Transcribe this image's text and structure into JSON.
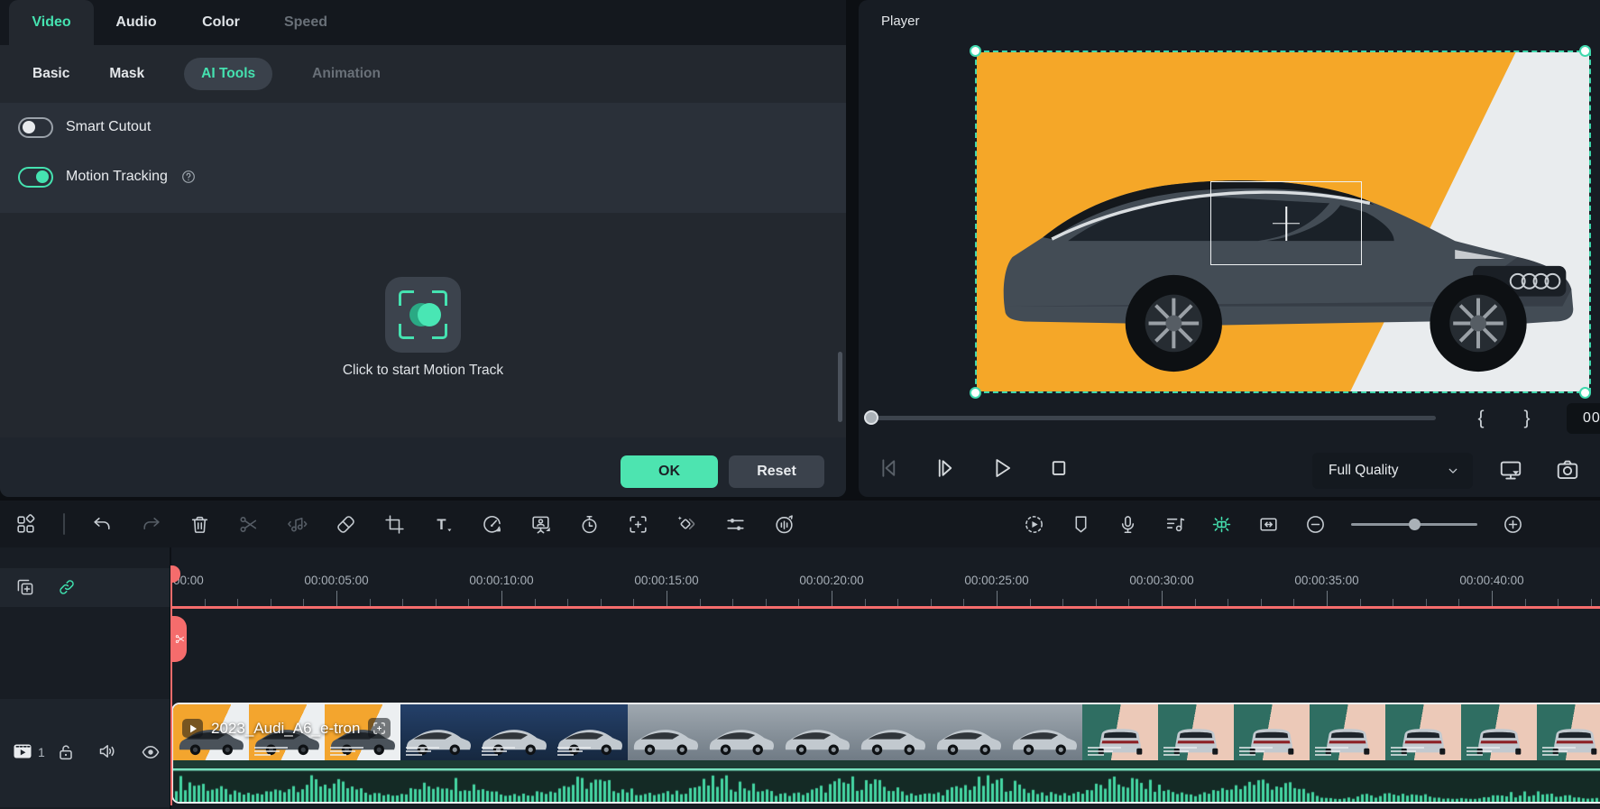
{
  "colors": {
    "accent": "#45e2b0",
    "red": "#f56c6c",
    "orange": "#f5a728",
    "ok_button": "#4de4b0"
  },
  "left_panel": {
    "tabs": [
      {
        "label": "Video",
        "state": "active"
      },
      {
        "label": "Audio",
        "state": "normal"
      },
      {
        "label": "Color",
        "state": "normal"
      },
      {
        "label": "Speed",
        "state": "disabled"
      }
    ],
    "subtabs": [
      {
        "label": "Basic",
        "state": "normal"
      },
      {
        "label": "Mask",
        "state": "normal"
      },
      {
        "label": "AI Tools",
        "state": "active"
      },
      {
        "label": "Animation",
        "state": "disabled"
      }
    ],
    "toggles": [
      {
        "label": "Smart Cutout",
        "on": false,
        "help": false
      },
      {
        "label": "Motion Tracking",
        "on": true,
        "help": true
      }
    ],
    "motion_track_button_icon": "motion-track-target",
    "motion_track_hint": "Click to start Motion Track",
    "buttons": {
      "ok": "OK",
      "reset": "Reset"
    }
  },
  "player": {
    "title": "Player",
    "mark_in": "{",
    "mark_out": "}",
    "timecode_partial": "00",
    "quality_selector": {
      "value": "Full Quality",
      "icon": "chevron-down"
    },
    "transport": [
      {
        "icon": "prev-frame",
        "dim": true
      },
      {
        "icon": "next-frame",
        "dim": false
      },
      {
        "icon": "play",
        "dim": false
      },
      {
        "icon": "stop",
        "dim": false
      }
    ],
    "tools": [
      {
        "icon": "monitor-detach"
      },
      {
        "icon": "camera-snapshot"
      }
    ]
  },
  "toolbar": {
    "left": [
      {
        "icon": "media-layout"
      },
      {
        "divider": true
      },
      {
        "icon": "undo"
      },
      {
        "icon": "redo",
        "dim": true
      },
      {
        "icon": "trash"
      },
      {
        "icon": "scissors",
        "dim": true
      },
      {
        "icon": "detach-audio",
        "dim": true
      },
      {
        "icon": "tag"
      },
      {
        "icon": "crop"
      },
      {
        "icon": "text-tool"
      },
      {
        "icon": "speed-dial"
      },
      {
        "icon": "presentation"
      },
      {
        "icon": "stopwatch"
      },
      {
        "icon": "motion-track-target"
      },
      {
        "icon": "keyframe"
      },
      {
        "icon": "adjust-sliders"
      },
      {
        "icon": "audio-cycle"
      }
    ],
    "right": [
      {
        "icon": "render-preview"
      },
      {
        "icon": "marker"
      },
      {
        "icon": "microphone"
      },
      {
        "icon": "audio-mixer"
      },
      {
        "icon": "auto-ripple",
        "active": true
      },
      {
        "icon": "fit-timeline"
      },
      {
        "icon": "zoom-out"
      },
      {
        "slider": true
      },
      {
        "icon": "zoom-in"
      }
    ]
  },
  "timeline": {
    "ruler_labels": [
      "00:00",
      "00:00:05:00",
      "00:00:10:00",
      "00:00:15:00",
      "00:00:20:00",
      "00:00:25:00",
      "00:00:30:00",
      "00:00:35:00",
      "00:00:40:00"
    ],
    "header_icons": [
      {
        "icon": "add-track"
      },
      {
        "icon": "link",
        "teal": true
      }
    ],
    "track_controls": {
      "type_icon": "video-track",
      "number": "1",
      "icons": [
        {
          "icon": "lock-open"
        },
        {
          "icon": "speaker"
        },
        {
          "icon": "eye"
        }
      ]
    },
    "clip": {
      "name": "2023_Audi_A6_e-tron",
      "overlay_icons": [
        "play-badge",
        "track-badge"
      ],
      "thumb_styles": [
        "orange",
        "orange",
        "orange",
        "navy",
        "navy",
        "navy",
        "gray",
        "gray",
        "gray",
        "gray",
        "gray",
        "gray",
        "tealpink",
        "tealpink",
        "tealpink",
        "tealpink",
        "tealpink",
        "tealpink",
        "tealpink"
      ]
    }
  }
}
